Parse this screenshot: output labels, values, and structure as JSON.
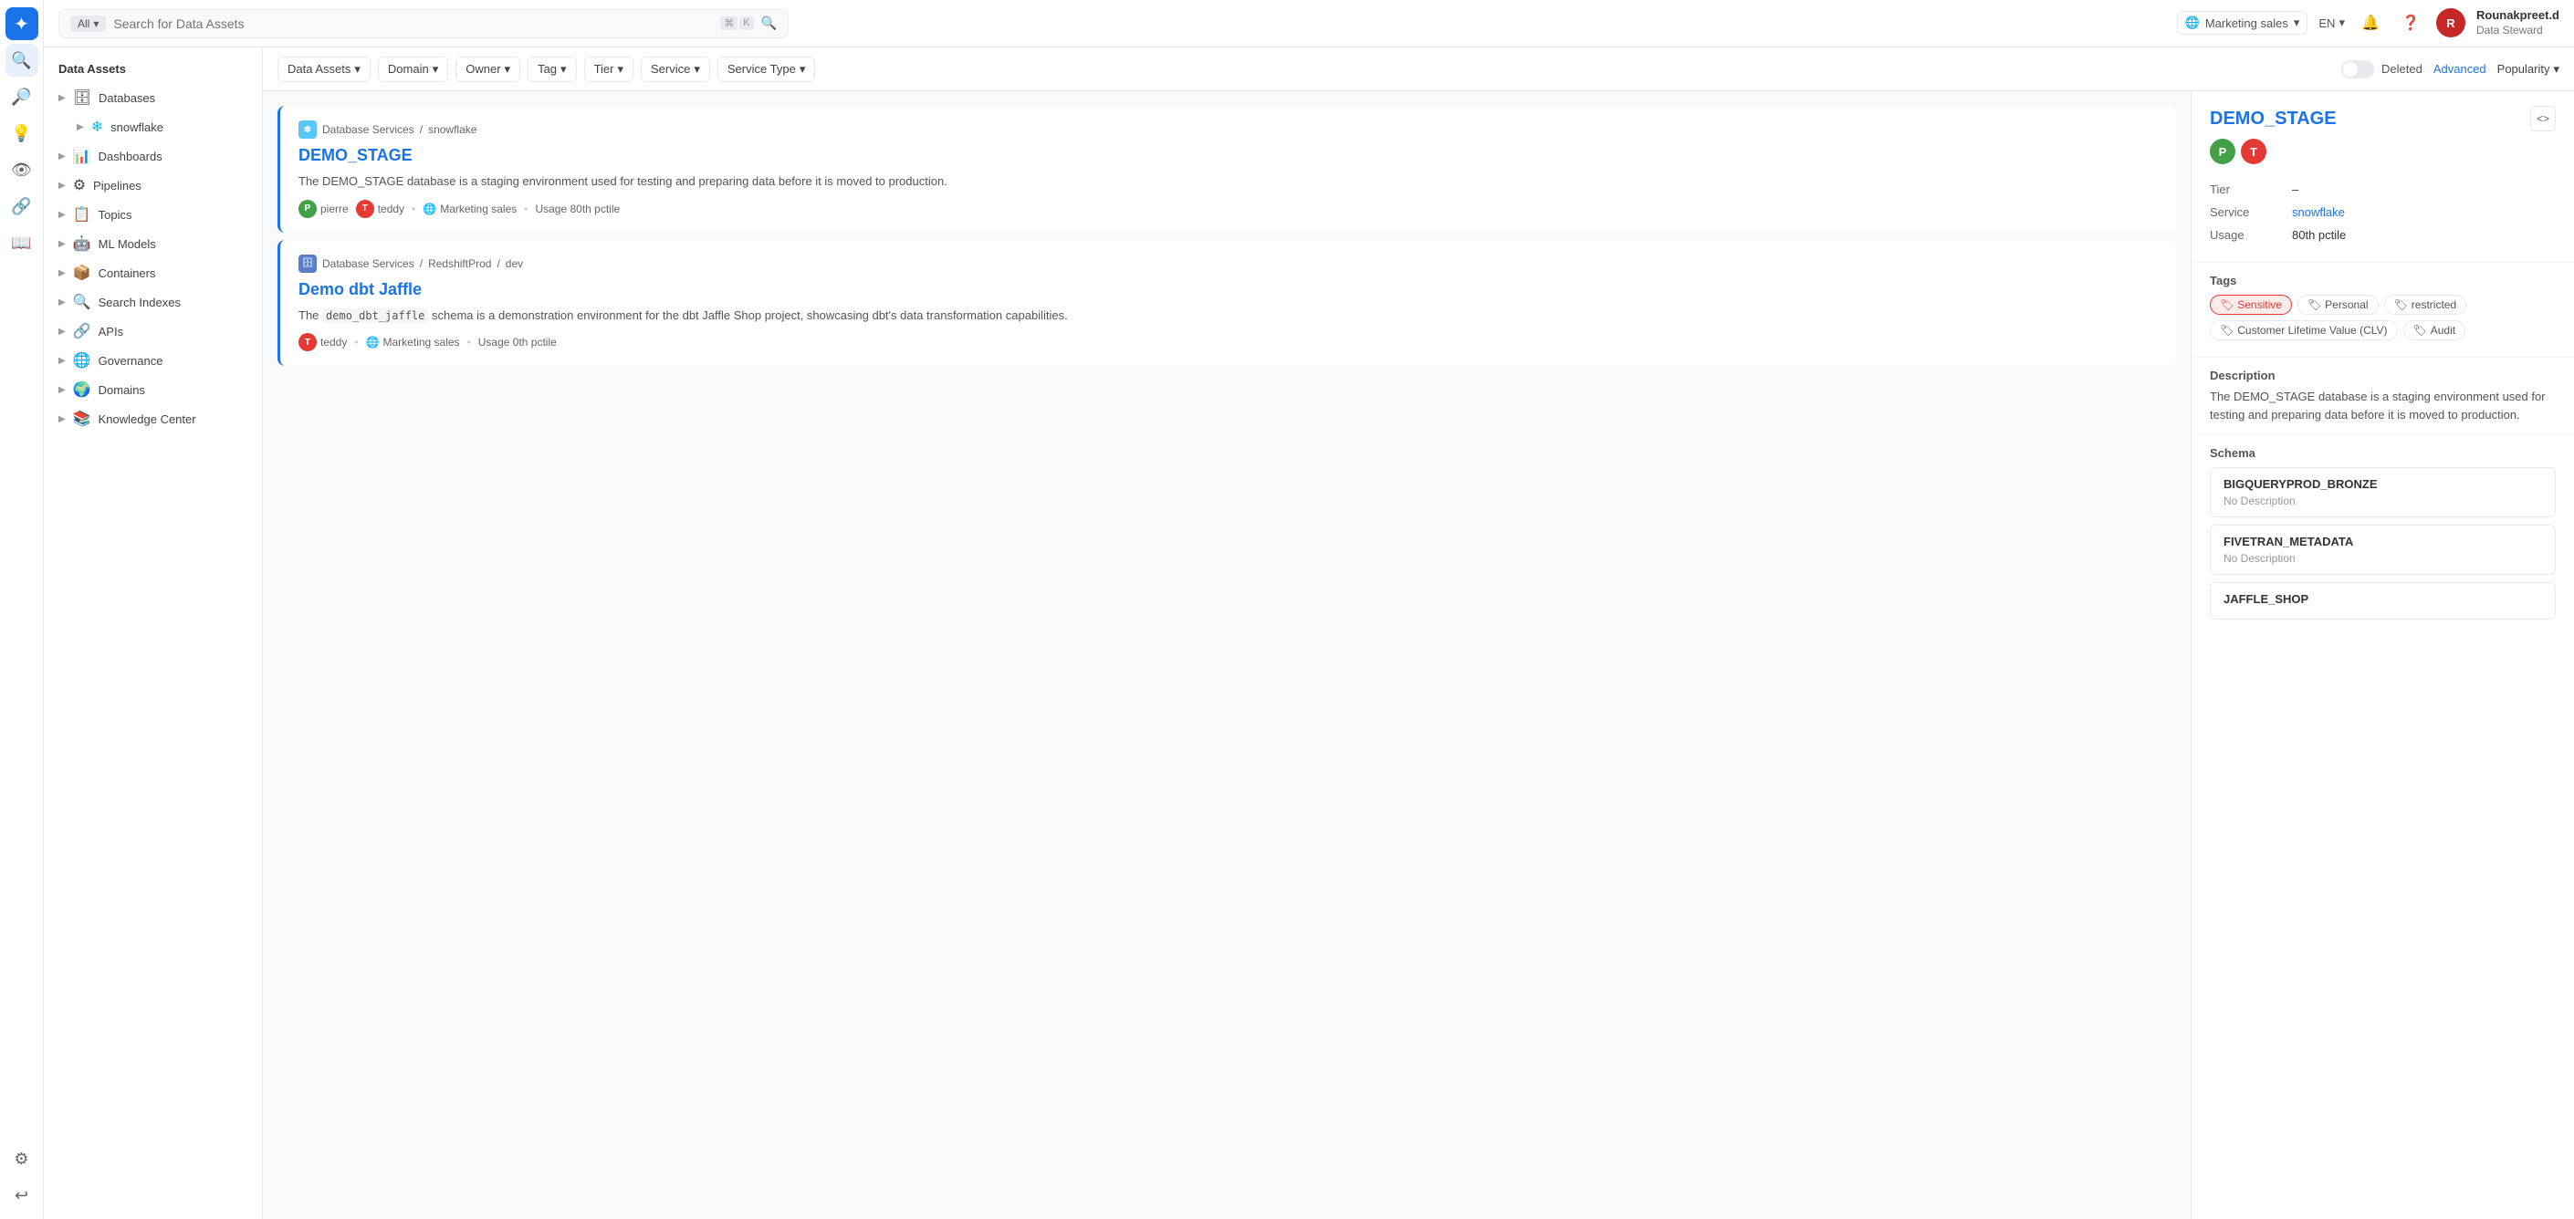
{
  "topbar": {
    "search_placeholder": "Search for Data Assets",
    "filter_all": "All",
    "workspace": "Marketing sales",
    "lang": "EN",
    "user_name": "Rounakpreet.d",
    "user_role": "Data Steward",
    "user_initial": "R"
  },
  "filter_bar": {
    "data_assets": "Data Assets",
    "domain": "Domain",
    "owner": "Owner",
    "tag": "Tag",
    "tier": "Tier",
    "service": "Service",
    "service_type": "Service Type",
    "deleted": "Deleted",
    "advanced": "Advanced",
    "popularity": "Popularity"
  },
  "sidebar": {
    "header": "Data Assets",
    "items": [
      {
        "label": "Databases",
        "icon": "🗄"
      },
      {
        "label": "snowflake",
        "icon": "❄",
        "sub": true
      },
      {
        "label": "Dashboards",
        "icon": "📊"
      },
      {
        "label": "Pipelines",
        "icon": "⚙"
      },
      {
        "label": "Topics",
        "icon": "📋"
      },
      {
        "label": "ML Models",
        "icon": "🤖"
      },
      {
        "label": "Containers",
        "icon": "📦"
      },
      {
        "label": "Search Indexes",
        "icon": "🔍"
      },
      {
        "label": "APIs",
        "icon": "🔗"
      },
      {
        "label": "Governance",
        "icon": "🌐"
      },
      {
        "label": "Domains",
        "icon": "🌍"
      },
      {
        "label": "Knowledge Center",
        "icon": "📚"
      }
    ]
  },
  "results": [
    {
      "id": "demo_stage",
      "breadcrumb": [
        "Database Services",
        "snowflake"
      ],
      "title": "DEMO_STAGE",
      "description": "The DEMO_STAGE database is a staging environment used for testing and preparing data before it is moved to production.",
      "owners": [
        {
          "name": "pierre",
          "color": "#43a047",
          "initial": "P"
        },
        {
          "name": "teddy",
          "color": "#e53935",
          "initial": "T"
        }
      ],
      "domain": "Marketing sales",
      "usage": "Usage 80th pctile"
    },
    {
      "id": "demo_dbt_jaffle",
      "breadcrumb": [
        "Database Services",
        "RedshiftProd",
        "dev"
      ],
      "title": "Demo dbt Jaffle",
      "description": "The demo_dbt_jaffle schema is a demonstration environment for the dbt Jaffle Shop project, showcasing dbt's data transformation capabilities.",
      "owners": [
        {
          "name": "teddy",
          "color": "#e53935",
          "initial": "T"
        }
      ],
      "domain": "Marketing sales",
      "usage": "Usage 0th pctile"
    }
  ],
  "detail_panel": {
    "title": "DEMO_STAGE",
    "owners": [
      {
        "name": "pierre",
        "color": "#43a047",
        "initial": "P"
      },
      {
        "name": "teddy",
        "color": "#e53935",
        "initial": "T"
      }
    ],
    "tier_label": "Tier",
    "tier_value": "–",
    "service_label": "Service",
    "service_value": "snowflake",
    "usage_label": "Usage",
    "usage_value": "80th pctile",
    "tags_label": "Tags",
    "tags": [
      {
        "label": "Sensitive",
        "type": "sensitive"
      },
      {
        "label": "Personal",
        "type": "personal"
      },
      {
        "label": "restricted",
        "type": "restricted"
      },
      {
        "label": "Customer Lifetime Value (CLV)",
        "type": "clv"
      },
      {
        "label": "Audit",
        "type": "audit"
      }
    ],
    "description_label": "Description",
    "description": "The DEMO_STAGE database is a staging environment used for testing and preparing data before it is moved to production.",
    "schema_label": "Schema",
    "schemas": [
      {
        "name": "BIGQUERYPROD_BRONZE",
        "desc": "No Description"
      },
      {
        "name": "FIVETRAN_METADATA",
        "desc": "No Description"
      },
      {
        "name": "JAFFLE_SHOP",
        "desc": ""
      }
    ]
  }
}
